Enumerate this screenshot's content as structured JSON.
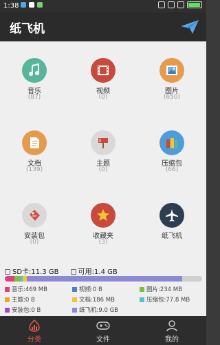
{
  "status": {
    "time": "1:38"
  },
  "app": {
    "title": "纸飞机"
  },
  "grid": [
    {
      "label": "音乐",
      "count": "(87)",
      "icon": "music-icon",
      "color": "#56b59a"
    },
    {
      "label": "视频",
      "count": "(0)",
      "icon": "video-icon",
      "color": "#c84a3c"
    },
    {
      "label": "图片",
      "count": "(650)",
      "icon": "image-icon",
      "color": "#e59a4c"
    },
    {
      "label": "文档",
      "count": "(139)",
      "icon": "document-icon",
      "color": "#e59a4c"
    },
    {
      "label": "主题",
      "count": "(0)",
      "icon": "theme-icon",
      "color": "#d9d9d9"
    },
    {
      "label": "压缩包",
      "count": "(66)",
      "icon": "archive-icon",
      "color": "#4d9ed8"
    },
    {
      "label": "安装包",
      "count": "(0)",
      "icon": "package-icon",
      "color": "#d9d9d9"
    },
    {
      "label": "收藏夹",
      "count": "(3)",
      "icon": "favorite-icon",
      "color": "#c84a3c"
    },
    {
      "label": "纸飞机",
      "count": "",
      "icon": "plane-icon",
      "color": "#2d3e50"
    }
  ],
  "storage": {
    "sd_label": "SD卡:11.3 GB",
    "free_label": "可用:1.4 GB",
    "bar": [
      {
        "name": "音乐",
        "fraction": 0.05,
        "color": "#e0407a"
      },
      {
        "name": "图片",
        "fraction": 0.03,
        "color": "#7fbf3f"
      },
      {
        "name": "压缩包",
        "fraction": 0.01,
        "color": "#4fc0e0"
      },
      {
        "name": "文档",
        "fraction": 0.02,
        "color": "#f3c13a"
      },
      {
        "name": "纸飞机",
        "fraction": 0.79,
        "color": "#8a8ad8"
      }
    ],
    "legend": [
      {
        "text": "音乐:469 MB",
        "color": "#e0407a"
      },
      {
        "text": "视频:0 B",
        "color": "#4d7fc8"
      },
      {
        "text": "图片:234 MB",
        "color": "#7fbf3f"
      },
      {
        "text": "主题:0 B",
        "color": "#f0a030"
      },
      {
        "text": "文档:186 MB",
        "color": "#f3c13a"
      },
      {
        "text": "压缩包:77.8 MB",
        "color": "#4fc0e0"
      },
      {
        "text": "安装包:0 B",
        "color": "#a04ac8"
      },
      {
        "text": "纸飞机:9.0 GB",
        "color": "#8a8ad8"
      }
    ]
  },
  "nav": [
    {
      "label": "分类",
      "icon": "category-icon"
    },
    {
      "label": "文件",
      "icon": "gamepad-icon"
    },
    {
      "label": "我的",
      "icon": "person-icon"
    }
  ]
}
